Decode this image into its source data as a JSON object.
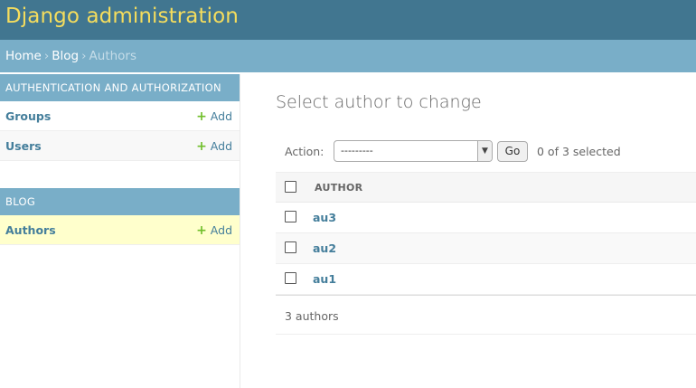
{
  "header": {
    "site_name": "Django administration"
  },
  "breadcrumbs": {
    "home": "Home",
    "sep": "›",
    "app": "Blog",
    "current": "Authors"
  },
  "sidebar": {
    "modules": [
      {
        "caption": "Authentication and Authorization",
        "rows": [
          {
            "label": "Groups",
            "add": "Add"
          },
          {
            "label": "Users",
            "add": "Add"
          }
        ]
      },
      {
        "caption": "Blog",
        "rows": [
          {
            "label": "Authors",
            "add": "Add"
          }
        ]
      }
    ]
  },
  "content": {
    "title": "Select author to change",
    "actions": {
      "label": "Action:",
      "selected_value": "---------",
      "go_label": "Go",
      "counter": "0 of 3 selected"
    },
    "table": {
      "column_header": "AUTHOR",
      "rows": [
        "au3",
        "au2",
        "au1"
      ]
    },
    "paginator": "3 authors"
  },
  "colors": {
    "header_bg": "#417690",
    "site_name": "#f5dd5d",
    "breadcrumbs_bg": "#79aec8",
    "link": "#447e9b",
    "add_icon": "#70bf2b",
    "selected_row": "#ffffcc"
  },
  "icons": {
    "add": "plus-icon",
    "dropdown": "chevron-down-icon"
  }
}
